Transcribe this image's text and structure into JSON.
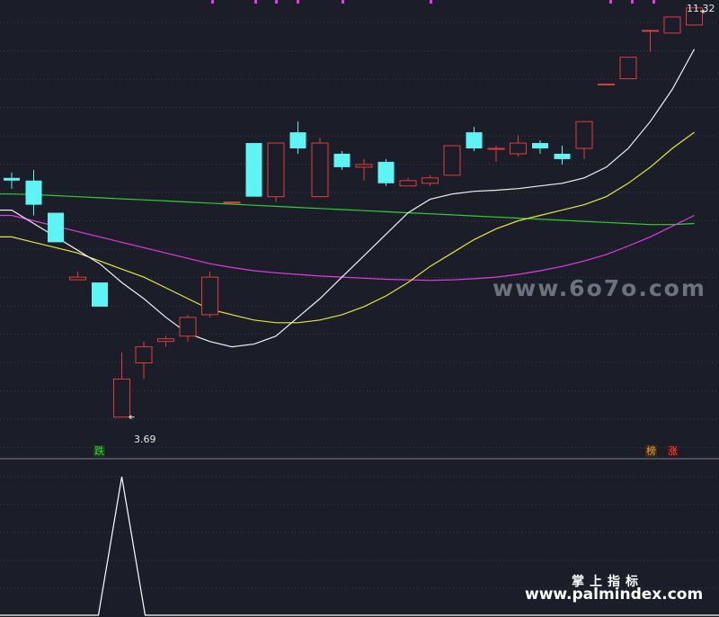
{
  "chart_data": {
    "type": "candlestick",
    "ylim": [
      3.3,
      11.4
    ],
    "colors": {
      "up": "#e03c3c",
      "down": "#5ef4f4",
      "ma5": "#f0f0f0",
      "ma10": "#e8e43c",
      "ma20": "#e03ce0",
      "ma60": "#33cc33",
      "indicator": "#ffffff"
    },
    "candles": [
      {
        "o": 8.15,
        "h": 8.25,
        "l": 7.95,
        "c": 8.1
      },
      {
        "o": 8.1,
        "h": 8.3,
        "l": 7.45,
        "c": 7.65
      },
      {
        "o": 7.5,
        "h": 7.5,
        "l": 6.95,
        "c": 6.95
      },
      {
        "o": 6.25,
        "h": 6.4,
        "l": 6.25,
        "c": 6.3
      },
      {
        "o": 6.2,
        "h": 6.2,
        "l": 5.75,
        "c": 5.75
      },
      {
        "o": 3.69,
        "h": 4.9,
        "l": 3.69,
        "c": 4.4
      },
      {
        "o": 4.7,
        "h": 5.1,
        "l": 4.4,
        "c": 5.0
      },
      {
        "o": 5.1,
        "h": 5.2,
        "l": 5.0,
        "c": 5.15
      },
      {
        "o": 5.2,
        "h": 5.6,
        "l": 5.1,
        "c": 5.55
      },
      {
        "o": 5.6,
        "h": 6.4,
        "l": 5.55,
        "c": 6.3
      },
      {
        "o": 7.7,
        "h": 7.7,
        "l": 7.65,
        "c": 7.7
      },
      {
        "o": 8.8,
        "h": 8.8,
        "l": 7.8,
        "c": 7.8
      },
      {
        "o": 7.8,
        "h": 8.8,
        "l": 7.7,
        "c": 8.8
      },
      {
        "o": 9.0,
        "h": 9.2,
        "l": 8.6,
        "c": 8.7
      },
      {
        "o": 7.8,
        "h": 8.9,
        "l": 7.8,
        "c": 8.8
      },
      {
        "o": 8.6,
        "h": 8.65,
        "l": 8.3,
        "c": 8.35
      },
      {
        "o": 8.35,
        "h": 8.5,
        "l": 8.1,
        "c": 8.4
      },
      {
        "o": 8.45,
        "h": 8.5,
        "l": 8.0,
        "c": 8.05
      },
      {
        "o": 8.0,
        "h": 8.15,
        "l": 8.0,
        "c": 8.1
      },
      {
        "o": 8.05,
        "h": 8.2,
        "l": 8.0,
        "c": 8.15
      },
      {
        "o": 8.2,
        "h": 8.75,
        "l": 8.2,
        "c": 8.75
      },
      {
        "o": 9.0,
        "h": 9.1,
        "l": 8.65,
        "c": 8.7
      },
      {
        "o": 8.7,
        "h": 8.75,
        "l": 8.45,
        "c": 8.7
      },
      {
        "o": 8.6,
        "h": 8.95,
        "l": 8.55,
        "c": 8.8
      },
      {
        "o": 8.8,
        "h": 8.85,
        "l": 8.6,
        "c": 8.7
      },
      {
        "o": 8.6,
        "h": 8.75,
        "l": 8.4,
        "c": 8.5
      },
      {
        "o": 8.7,
        "h": 9.2,
        "l": 8.5,
        "c": 9.2
      },
      {
        "o": 9.9,
        "h": 9.9,
        "l": 9.9,
        "c": 9.9
      },
      {
        "o": 10.0,
        "h": 10.4,
        "l": 10.0,
        "c": 10.4
      },
      {
        "o": 10.9,
        "h": 10.9,
        "l": 10.5,
        "c": 10.9
      },
      {
        "o": 10.85,
        "h": 11.15,
        "l": 10.85,
        "c": 11.15
      },
      {
        "o": 11.0,
        "h": 11.32,
        "l": 11.0,
        "c": 11.32
      }
    ],
    "ma5": [
      7.55,
      7.3,
      7.05,
      6.8,
      6.55,
      6.2,
      5.9,
      5.55,
      5.25,
      5.1,
      5.0,
      5.05,
      5.2,
      5.55,
      5.9,
      6.3,
      6.7,
      7.1,
      7.5,
      7.75,
      7.85,
      7.9,
      7.92,
      7.95,
      8.0,
      8.05,
      8.15,
      8.35,
      8.7,
      9.2,
      9.8,
      10.55
    ],
    "ma10": [
      7.05,
      6.95,
      6.85,
      6.75,
      6.6,
      6.45,
      6.3,
      6.1,
      5.9,
      5.7,
      5.6,
      5.5,
      5.45,
      5.45,
      5.5,
      5.6,
      5.75,
      5.95,
      6.2,
      6.5,
      6.75,
      7.0,
      7.2,
      7.35,
      7.45,
      7.55,
      7.65,
      7.8,
      8.05,
      8.35,
      8.7,
      9.0
    ],
    "ma20": [
      7.45,
      7.35,
      7.25,
      7.15,
      7.05,
      6.95,
      6.85,
      6.75,
      6.65,
      6.55,
      6.48,
      6.42,
      6.38,
      6.35,
      6.32,
      6.3,
      6.28,
      6.26,
      6.25,
      6.24,
      6.25,
      6.27,
      6.3,
      6.35,
      6.42,
      6.5,
      6.6,
      6.72,
      6.88,
      7.05,
      7.25,
      7.45
    ],
    "ma60": [
      7.85,
      7.84,
      7.82,
      7.8,
      7.78,
      7.76,
      7.74,
      7.72,
      7.7,
      7.68,
      7.66,
      7.64,
      7.62,
      7.6,
      7.58,
      7.56,
      7.54,
      7.52,
      7.5,
      7.48,
      7.46,
      7.44,
      7.42,
      7.4,
      7.38,
      7.36,
      7.34,
      7.32,
      7.3,
      7.28,
      7.28,
      7.3
    ],
    "low_label": "3.69",
    "high_label": "11.32",
    "badges": {
      "fall": "跌",
      "list": "榜",
      "rise": "涨"
    },
    "indicator": {
      "ylim": [
        0,
        1
      ],
      "values": [
        0,
        0,
        0,
        0,
        0,
        1,
        0,
        0,
        0,
        0,
        0,
        0,
        0,
        0,
        0,
        0,
        0,
        0,
        0,
        0,
        0,
        0,
        0,
        0,
        0,
        0,
        0,
        0,
        0,
        0,
        0,
        0
      ]
    }
  },
  "watermarks": {
    "center": "www.6o7o.com",
    "brand_cn": "掌上指标",
    "brand_url": "www.palmindex.com"
  }
}
